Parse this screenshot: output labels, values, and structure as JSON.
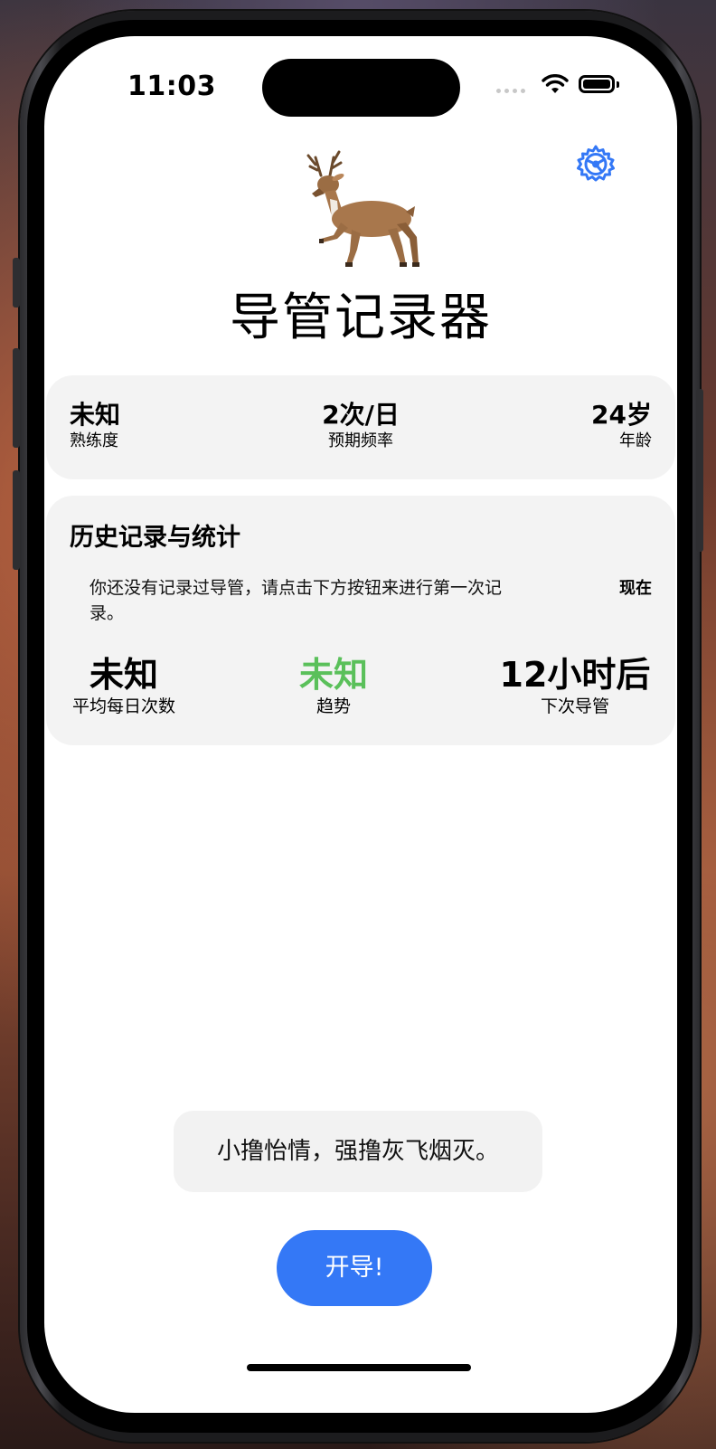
{
  "status_bar": {
    "time": "11:03"
  },
  "header": {
    "title": "导管记录器",
    "logo_icon": "deer-emoji",
    "settings_icon": "gear-icon"
  },
  "summary": {
    "proficiency": {
      "value": "未知",
      "label": "熟练度"
    },
    "expected_frequency": {
      "value": "2次/日",
      "label": "预期频率"
    },
    "age": {
      "value": "24岁",
      "label": "年龄"
    }
  },
  "history": {
    "title": "历史记录与统计",
    "empty_message": "你还没有记录过导管，请点击下方按钮来进行第一次记录。",
    "time_label": "现在",
    "avg_daily": {
      "value": "未知",
      "label": "平均每日次数"
    },
    "trend": {
      "value": "未知",
      "label": "趋势"
    },
    "next": {
      "value": "12小时后",
      "label": "下次导管"
    }
  },
  "quote": "小撸怡情，强撸灰飞烟灭。",
  "start_button": "开导!",
  "colors": {
    "accent": "#3478f6",
    "trend_green": "#5ac05a",
    "card_bg": "#f3f3f3"
  }
}
